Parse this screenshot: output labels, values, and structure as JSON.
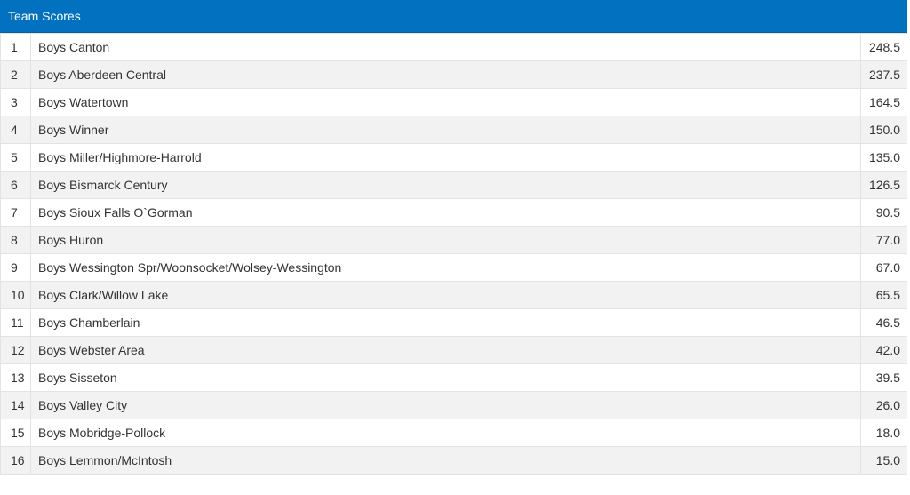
{
  "header": {
    "title": "Team Scores"
  },
  "rows": [
    {
      "rank": "1",
      "team": "Boys Canton",
      "score": "248.5"
    },
    {
      "rank": "2",
      "team": "Boys Aberdeen Central",
      "score": "237.5"
    },
    {
      "rank": "3",
      "team": "Boys Watertown",
      "score": "164.5"
    },
    {
      "rank": "4",
      "team": "Boys Winner",
      "score": "150.0"
    },
    {
      "rank": "5",
      "team": "Boys Miller/Highmore-Harrold",
      "score": "135.0"
    },
    {
      "rank": "6",
      "team": "Boys Bismarck Century",
      "score": "126.5"
    },
    {
      "rank": "7",
      "team": "Boys Sioux Falls O`Gorman",
      "score": "90.5"
    },
    {
      "rank": "8",
      "team": "Boys Huron",
      "score": "77.0"
    },
    {
      "rank": "9",
      "team": "Boys Wessington Spr/Woonsocket/Wolsey-Wessington",
      "score": "67.0"
    },
    {
      "rank": "10",
      "team": "Boys Clark/Willow Lake",
      "score": "65.5"
    },
    {
      "rank": "11",
      "team": "Boys Chamberlain",
      "score": "46.5"
    },
    {
      "rank": "12",
      "team": "Boys Webster Area",
      "score": "42.0"
    },
    {
      "rank": "13",
      "team": "Boys Sisseton",
      "score": "39.5"
    },
    {
      "rank": "14",
      "team": "Boys Valley City",
      "score": "26.0"
    },
    {
      "rank": "15",
      "team": "Boys Mobridge-Pollock",
      "score": "18.0"
    },
    {
      "rank": "16",
      "team": "Boys Lemmon/McIntosh",
      "score": "15.0"
    }
  ],
  "colors": {
    "header_bg": "#0171c0",
    "header_text": "#ffffff",
    "row_alt_bg": "#f2f2f2",
    "border": "#e3e3e3",
    "text": "#333333"
  }
}
